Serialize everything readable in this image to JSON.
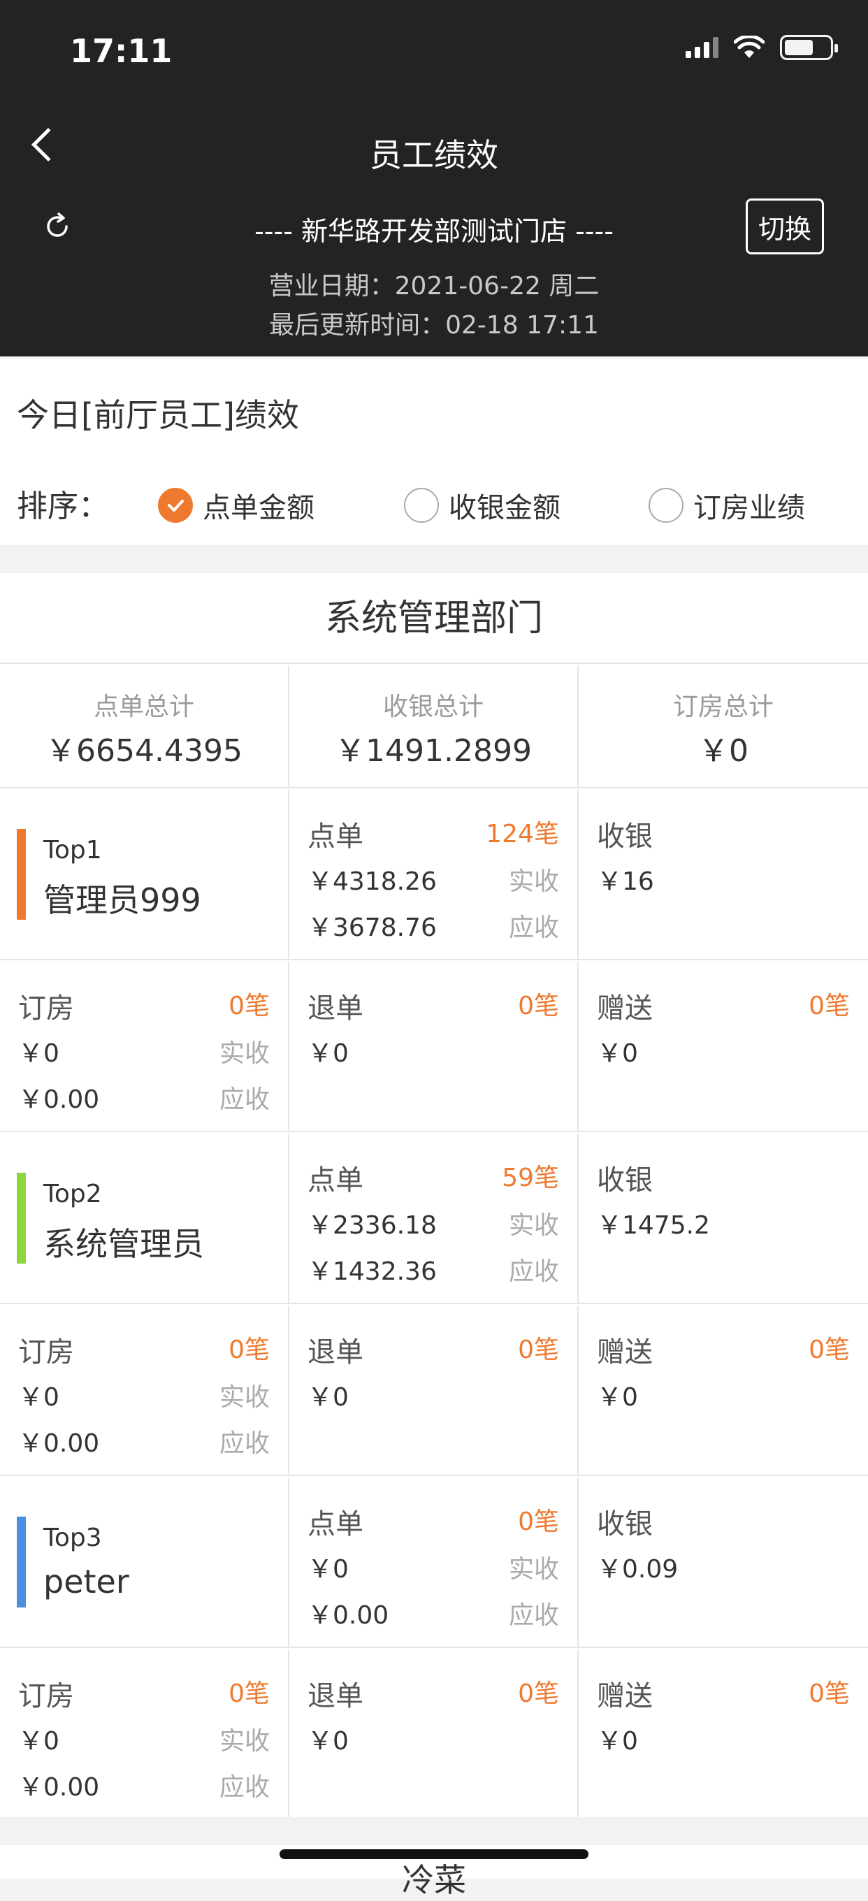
{
  "status_bar": {
    "time": "17:11"
  },
  "nav": {
    "title": "员工绩效",
    "back_icon": "chevron-left-icon",
    "refresh_icon": "refresh-icon"
  },
  "store": {
    "name": "---- 新华路开发部测试门店 ----",
    "switch_label": "切换",
    "business_date": "营业日期：2021-06-22 周二",
    "last_updated": "最后更新时间：02-18 17:11"
  },
  "section": {
    "title": "今日[前厅员工]绩效",
    "sort_label": "排序：",
    "sort_options": [
      {
        "label": "点单金额",
        "checked": true
      },
      {
        "label": "收银金额",
        "checked": false
      },
      {
        "label": "订房业绩",
        "checked": false
      }
    ]
  },
  "department": {
    "name": "系统管理部门",
    "totals": [
      {
        "label": "点单总计",
        "value": "￥6654.4395"
      },
      {
        "label": "收银总计",
        "value": "￥1491.2899"
      },
      {
        "label": "订房总计",
        "value": "￥0"
      }
    ]
  },
  "labels": {
    "order": "点单",
    "cashier": "收银",
    "booking": "订房",
    "refund": "退单",
    "gift": "赠送",
    "received": "实收",
    "receivable": "应收"
  },
  "colors": {
    "accent": "#ef7a2f",
    "top1": "#ef7a2f",
    "top2": "#8ed640",
    "top3": "#4a8fe0"
  },
  "employees": [
    {
      "rank": "Top1",
      "name": "管理员999",
      "order": {
        "count": "124笔",
        "received": "￥4318.26",
        "receivable": "￥3678.76"
      },
      "cashier": {
        "value": "￥16"
      },
      "booking": {
        "count": "0笔",
        "received": "￥0",
        "receivable": "￥0.00"
      },
      "refund": {
        "count": "0笔",
        "value": "￥0"
      },
      "gift": {
        "count": "0笔",
        "value": "￥0"
      }
    },
    {
      "rank": "Top2",
      "name": "系统管理员",
      "order": {
        "count": "59笔",
        "received": "￥2336.18",
        "receivable": "￥1432.36"
      },
      "cashier": {
        "value": "￥1475.2"
      },
      "booking": {
        "count": "0笔",
        "received": "￥0",
        "receivable": "￥0.00"
      },
      "refund": {
        "count": "0笔",
        "value": "￥0"
      },
      "gift": {
        "count": "0笔",
        "value": "￥0"
      }
    },
    {
      "rank": "Top3",
      "name": "peter",
      "order": {
        "count": "0笔",
        "received": "￥0",
        "receivable": "￥0.00"
      },
      "cashier": {
        "value": "￥0.09"
      },
      "booking": {
        "count": "0笔",
        "received": "￥0",
        "receivable": "￥0.00"
      },
      "refund": {
        "count": "0笔",
        "value": "￥0"
      },
      "gift": {
        "count": "0笔",
        "value": "￥0"
      }
    }
  ],
  "bottom_peek": "冷菜"
}
